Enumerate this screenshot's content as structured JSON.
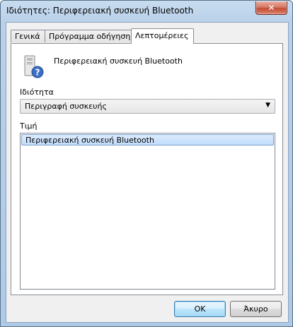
{
  "window": {
    "title": "Ιδιότητες: Περιφερειακή συσκευή Bluetooth",
    "close_label": "✕"
  },
  "tabs": [
    {
      "label": "Γενικά",
      "active": false
    },
    {
      "label": "Πρόγραμμα οδήγησης",
      "active": false
    },
    {
      "label": "Λεπτομέρειες",
      "active": true
    }
  ],
  "device": {
    "name": "Περιφερειακή συσκευή Bluetooth",
    "icon": "unknown-device-icon"
  },
  "property": {
    "label": "Ιδιότητα",
    "selected": "Περιγραφή συσκευής"
  },
  "value": {
    "label": "Τιμή",
    "items": [
      "Περιφερειακή συσκευή Bluetooth"
    ]
  },
  "buttons": {
    "ok": "OK",
    "cancel": "Άκυρο"
  }
}
